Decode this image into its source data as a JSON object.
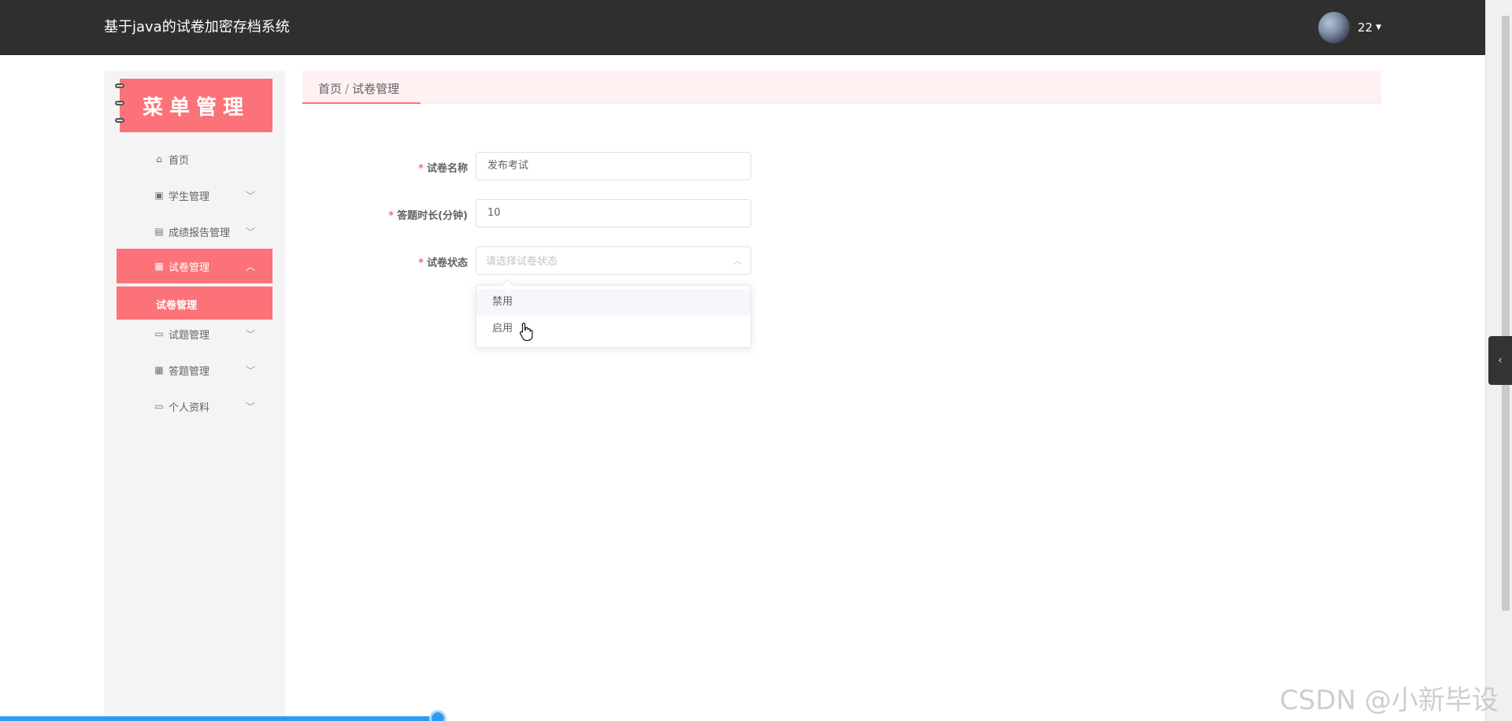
{
  "header": {
    "app_title": "基于java的试卷加密存档系统",
    "user_name": "22"
  },
  "sidebar": {
    "banner_title": "菜单管理",
    "items": [
      {
        "label": "首页",
        "icon": "home-icon",
        "has_arrow": false
      },
      {
        "label": "学生管理",
        "icon": "clipboard-icon",
        "has_arrow": true
      },
      {
        "label": "成绩报告管理",
        "icon": "chart-icon",
        "has_arrow": true
      },
      {
        "label": "试卷管理",
        "icon": "grid-icon",
        "has_arrow": true,
        "active": true
      },
      {
        "label": "试题管理",
        "icon": "monitor-icon",
        "has_arrow": true
      },
      {
        "label": "答题管理",
        "icon": "grid-icon",
        "has_arrow": true
      },
      {
        "label": "个人资料",
        "icon": "card-icon",
        "has_arrow": true
      }
    ],
    "submenu": {
      "label": "试卷管理"
    }
  },
  "breadcrumb": {
    "home": "首页",
    "separator": "/",
    "current": "试卷管理"
  },
  "form": {
    "name": {
      "label": "试卷名称",
      "value": "发布考试"
    },
    "duration": {
      "label": "答题时长(分钟)",
      "value": "10"
    },
    "status": {
      "label": "试卷状态",
      "placeholder": "请选择试卷状态"
    }
  },
  "dropdown": {
    "options": [
      "禁用",
      "启用"
    ]
  },
  "watermark": "CSDN @小新毕设",
  "colors": {
    "accent": "#fb7378",
    "topbar": "#2f2f2f",
    "sidebar": "#f4f4f5"
  }
}
